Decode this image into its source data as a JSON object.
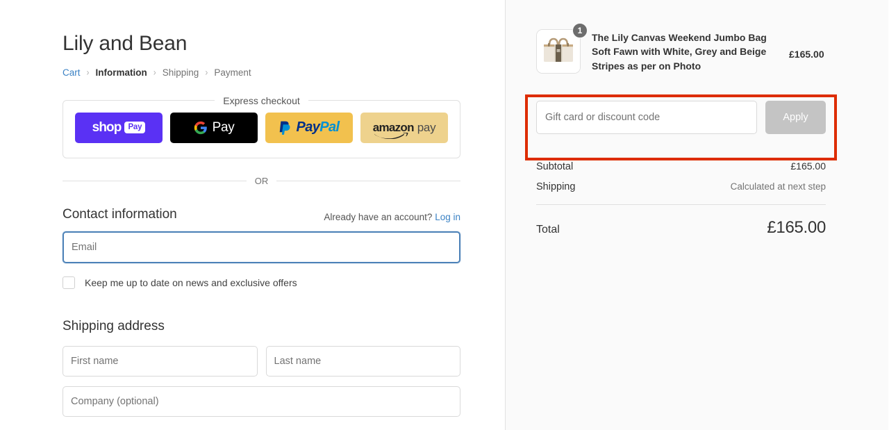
{
  "shop": {
    "title": "Lily and Bean"
  },
  "breadcrumb": {
    "items": [
      {
        "label": "Cart",
        "state": "link"
      },
      {
        "label": "Information",
        "state": "current"
      },
      {
        "label": "Shipping",
        "state": "upcoming"
      },
      {
        "label": "Payment",
        "state": "upcoming"
      }
    ],
    "separator": "›"
  },
  "express": {
    "legend": "Express checkout",
    "buttons": [
      {
        "name": "shop-pay",
        "word": "shop",
        "badge": "Pay",
        "bg": "#5a31f4"
      },
      {
        "name": "google-pay",
        "mark": "G",
        "word": "Pay",
        "bg": "#000000"
      },
      {
        "name": "paypal",
        "part1": "Pay",
        "part2": "Pal",
        "bg": "#f2c14e"
      },
      {
        "name": "amazon-pay",
        "part1": "amazon",
        "part2": "pay",
        "bg": "#eed28d"
      }
    ]
  },
  "divider": {
    "or": "OR"
  },
  "contact": {
    "title": "Contact information",
    "account_note": "Already have an account?",
    "login_label": "Log in",
    "email_placeholder": "Email",
    "newsletter_label": "Keep me up to date on news and exclusive offers",
    "newsletter_checked": false
  },
  "shipping_address": {
    "title": "Shipping address",
    "first_name_placeholder": "First name",
    "last_name_placeholder": "Last name",
    "company_placeholder": "Company (optional)"
  },
  "order_summary": {
    "item": {
      "quantity": "1",
      "title": "The Lily Canvas Weekend Jumbo Bag Soft Fawn with White, Grey and Beige Stripes as per on Photo",
      "price": "£165.00"
    },
    "discount": {
      "placeholder": "Gift card or discount code",
      "value": "",
      "apply_label": "Apply",
      "apply_disabled": true,
      "highlight_color": "#dd2c00"
    },
    "totals": [
      {
        "label": "Subtotal",
        "value": "£165.00",
        "muted": false
      },
      {
        "label": "Shipping",
        "value": "Calculated at next step",
        "muted": true
      }
    ],
    "grand_total": {
      "label": "Total",
      "value": "£165.00"
    }
  }
}
